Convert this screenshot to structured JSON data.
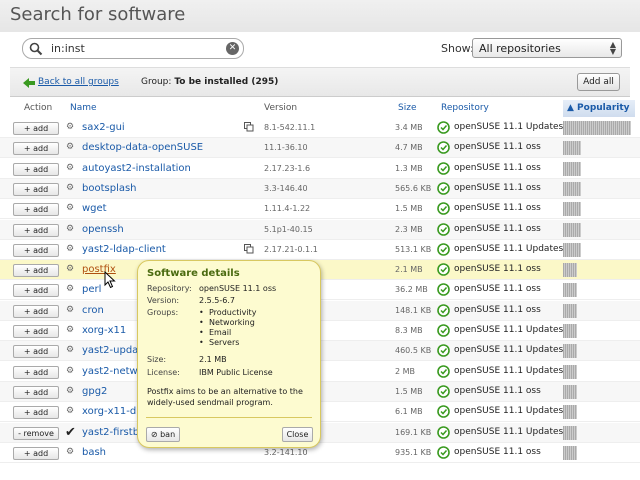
{
  "page_title": "Search for software",
  "search": {
    "value": "in:inst"
  },
  "show": {
    "label": "Show:",
    "selected": "All repositories"
  },
  "group_bar": {
    "back_label": "Back to all groups",
    "group_prefix": "Group:",
    "group_name": "To be installed (295)",
    "add_all_label": "Add all"
  },
  "columns": {
    "action": "Action",
    "name": "Name",
    "version": "Version",
    "size": "Size",
    "repository": "Repository",
    "popularity": "▲ Popularity"
  },
  "rows": [
    {
      "action": "+ add",
      "name": "sax2-gui",
      "version": "8.1-542.11.1",
      "size": "3.4 MB",
      "repository": "openSUSE 11.1 Updates",
      "popularity": 1.0,
      "info": true,
      "installed": false
    },
    {
      "action": "+ add",
      "name": "desktop-data-openSUSE",
      "version": "11.1-36.10",
      "size": "4.7 MB",
      "repository": "openSUSE 11.1 oss",
      "popularity": 0.27,
      "info": false,
      "installed": false
    },
    {
      "action": "+ add",
      "name": "autoyast2-installation",
      "version": "2.17.23-1.6",
      "size": "1.3 MB",
      "repository": "openSUSE 11.1 oss",
      "popularity": 0.27,
      "info": false,
      "installed": false
    },
    {
      "action": "+ add",
      "name": "bootsplash",
      "version": "3.3-146.40",
      "size": "565.6 KB",
      "repository": "openSUSE 11.1 oss",
      "popularity": 0.27,
      "info": false,
      "installed": false
    },
    {
      "action": "+ add",
      "name": "wget",
      "version": "1.11.4-1.22",
      "size": "1.5 MB",
      "repository": "openSUSE 11.1 oss",
      "popularity": 0.27,
      "info": false,
      "installed": false
    },
    {
      "action": "+ add",
      "name": "openssh",
      "version": "5.1p1-40.15",
      "size": "2.3 MB",
      "repository": "openSUSE 11.1 oss",
      "popularity": 0.27,
      "info": false,
      "installed": false
    },
    {
      "action": "+ add",
      "name": "yast2-ldap-client",
      "version": "2.17.21-0.1.1",
      "size": "513.1 KB",
      "repository": "openSUSE 11.1 Updates",
      "popularity": 0.27,
      "info": true,
      "installed": false
    },
    {
      "action": "+ add",
      "name": "postfix",
      "version": "",
      "size": "2.1 MB",
      "repository": "openSUSE 11.1 oss",
      "popularity": 0.2,
      "info": false,
      "installed": false,
      "highlight": true
    },
    {
      "action": "+ add",
      "name": "perl",
      "version": "",
      "size": "36.2 MB",
      "repository": "openSUSE 11.1 oss",
      "popularity": 0.2,
      "info": false,
      "installed": false
    },
    {
      "action": "+ add",
      "name": "cron",
      "version": "",
      "size": "148.1 KB",
      "repository": "openSUSE 11.1 oss",
      "popularity": 0.2,
      "info": false,
      "installed": false
    },
    {
      "action": "+ add",
      "name": "xorg-x11",
      "version": "",
      "size": "8.3 MB",
      "repository": "openSUSE 11.1 Updates",
      "popularity": 0.2,
      "info": false,
      "installed": false
    },
    {
      "action": "+ add",
      "name": "yast2-update",
      "version": "",
      "size": "460.5 KB",
      "repository": "openSUSE 11.1 Updates",
      "popularity": 0.2,
      "info": false,
      "installed": false
    },
    {
      "action": "+ add",
      "name": "yast2-network",
      "version": "",
      "size": "2 MB",
      "repository": "openSUSE 11.1 Updates",
      "popularity": 0.2,
      "info": false,
      "installed": false
    },
    {
      "action": "+ add",
      "name": "gpg2",
      "version": "",
      "size": "1.5 MB",
      "repository": "openSUSE 11.1 oss",
      "popularity": 0.2,
      "info": false,
      "installed": false
    },
    {
      "action": "+ add",
      "name": "xorg-x11-driver",
      "version": "",
      "size": "6.1 MB",
      "repository": "openSUSE 11.1 Updates",
      "popularity": 0.2,
      "info": false,
      "installed": false
    },
    {
      "action": "- remove",
      "name": "yast2-firstboot",
      "version": "",
      "size": "169.1 KB",
      "repository": "openSUSE 11.1 Updates",
      "popularity": 0.2,
      "info": false,
      "installed": true
    },
    {
      "action": "+ add",
      "name": "bash",
      "version": "3.2-141.10",
      "size": "935.1 KB",
      "repository": "openSUSE 11.1 oss",
      "popularity": 0.2,
      "info": false,
      "installed": false
    }
  ],
  "popup": {
    "title": "Software details",
    "repository_label": "Repository:",
    "repository_value": "openSUSE 11.1 oss",
    "version_label": "Version:",
    "version_value": "2.5.5-6.7",
    "groups_label": "Groups:",
    "groups": [
      "Productivity",
      "Networking",
      "Email",
      "Servers"
    ],
    "size_label": "Size:",
    "size_value": "2.1 MB",
    "license_label": "License:",
    "license_value": "IBM Public License",
    "description": "Postfix aims to be an alternative to the widely-used sendmail program.",
    "ban_label": "⊘ ban",
    "close_label": "Close"
  },
  "colors": {
    "link": "#1a5aa8",
    "highlight_row": "#fbf8c8",
    "popup_bg": "#fdfbd0",
    "repo_icon": "#3a9a20"
  }
}
